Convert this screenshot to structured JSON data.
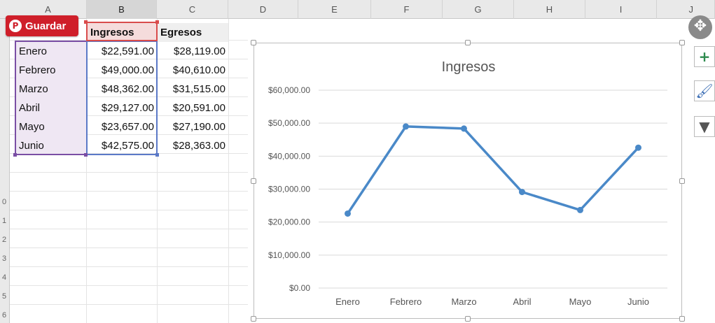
{
  "columns": [
    "A",
    "B",
    "C",
    "D",
    "E",
    "F",
    "G",
    "H",
    "I",
    "J"
  ],
  "row_numbers": [
    "0",
    "1",
    "2",
    "3",
    "4",
    "5",
    "6"
  ],
  "save_button": {
    "label": "Guardar",
    "icon": "pinterest-icon"
  },
  "table": {
    "headers": [
      "Ingresos",
      "Egresos"
    ],
    "rows": [
      {
        "month": "Enero",
        "ingresos": "$22,591.00",
        "egresos": "$28,119.00"
      },
      {
        "month": "Febrero",
        "ingresos": "$49,000.00",
        "egresos": "$40,610.00"
      },
      {
        "month": "Marzo",
        "ingresos": "$48,362.00",
        "egresos": "$31,515.00"
      },
      {
        "month": "Abril",
        "ingresos": "$29,127.00",
        "egresos": "$20,591.00"
      },
      {
        "month": "Mayo",
        "ingresos": "$23,657.00",
        "egresos": "$27,190.00"
      },
      {
        "month": "Junio",
        "ingresos": "$42,575.00",
        "egresos": "$28,363.00"
      }
    ]
  },
  "tools": [
    "plus-icon",
    "brush-icon",
    "filter-icon",
    "move-icon"
  ],
  "colors": {
    "series": "#4a89c8",
    "save_button": "#cf1f2a"
  },
  "chart_data": {
    "type": "line",
    "title": "Ingresos",
    "categories": [
      "Enero",
      "Febrero",
      "Marzo",
      "Abril",
      "Mayo",
      "Junio"
    ],
    "values": [
      22591,
      49000,
      48362,
      29127,
      23657,
      42575
    ],
    "ylim": [
      0,
      60000
    ],
    "yticks": [
      "$0.00",
      "$10,000.00",
      "$20,000.00",
      "$30,000.00",
      "$40,000.00",
      "$50,000.00",
      "$60,000.00"
    ],
    "grid": true,
    "legend": "none"
  }
}
